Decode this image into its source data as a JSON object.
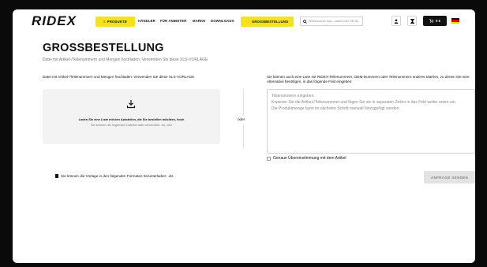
{
  "header": {
    "logo": "RIDEX",
    "products_label": "PRODUKTE",
    "nav_links": [
      "HÄNDLER",
      "FÜR ANBIETER",
      "MARKE",
      "DOWNLOADS"
    ],
    "bulk_order_label": "GROSSBESTELLUNG",
    "search_placeholder": "Teilenummer bzw. -name oder OE-Nu",
    "cart_amount": "0 €",
    "icons": [
      "hamburger-icon",
      "search-icon",
      "user-icon",
      "hourglass-icon",
      "cart-icon",
      "germany-flag-icon"
    ]
  },
  "main": {
    "title": "GROSSBESTELLUNG",
    "subtitle": "Datei mit Artikel-/Teilenummern und Mengen hochladen: Verwenden Sie diese XLS-VORLAGE",
    "left_label": "Datei mit Artikel-/Teilenummern und Mengen hochladen: Verwenden Sie diese XLS-VORLAGE",
    "upload_text": "Laden Sie eine Liste mit den Autoteilen, die Sie bestellen möchten, hoch",
    "upload_sub": "Sie können die folgenden Dateiformate verwenden: xls, xlsx",
    "divider_label": "oder",
    "right_label": "Sie können auch eine Liste mit RIDEX-Teilenummern, OEM-Nummern oder Teilenummern anderer Marken, zu denen Sie eine Alternative benötigen, in das folgende Feld eingeben:",
    "textarea_lines": [
      "Teilenummern eingeben:",
      "Kopieren Sie die Artikel-/Teilenummern und fügen Sie sie in separaten Zeilen in das Feld weiter unten ein.",
      "Die Produktmenge kann im nächsten Schritt manuell hinzugefügt werden."
    ],
    "exact_match_label": "Genaue Übereinstimmung mit dem Artikel",
    "template_note": "Sie können die Vorlage in den folgenden Formaten herunterladen: .xls",
    "send_button": "ANFRAGE SENDEN"
  },
  "colors": {
    "accent": "#f5e219",
    "text": "#111111",
    "muted": "#777777"
  }
}
